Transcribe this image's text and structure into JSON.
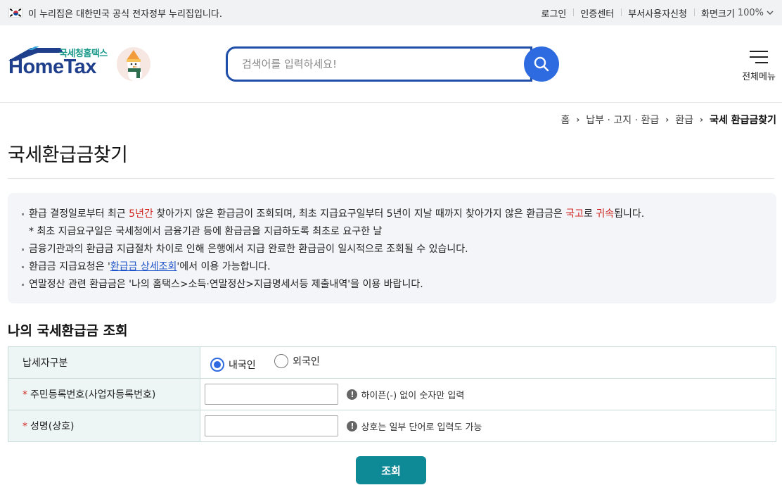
{
  "gov_bar": {
    "notice": "이 누리집은 대한민국 공식 전자정부 누리집입니다.",
    "links": [
      "로그인",
      "인증센터",
      "부서사용자신청"
    ],
    "zoom_label": "화면크기",
    "zoom_value": "100%"
  },
  "header": {
    "logo_sub": "국세청홈택스",
    "logo_main": "HomeTax",
    "search_placeholder": "검색어를 입력하세요!",
    "menu_label": "전체메뉴"
  },
  "breadcrumb": [
    "홈",
    "납부 · 고지 · 환급",
    "환급",
    "국세 환급금찾기"
  ],
  "page_title": "국세환급금찾기",
  "info": {
    "line1_a": "환급 결정일로부터 최근 ",
    "line1_red1": "5년간",
    "line1_b": " 찾아가지 않은 환급금이 조회되며, 최초 지급요구일부터 5년이 지날 때까지 찾아가지 않은 환급금은 ",
    "line1_red2": "국고",
    "line1_c": "로 ",
    "line1_red3": "귀속",
    "line1_d": "됩니다.",
    "note": "* 최초 지급요구일은 국세청에서 금융기관 등에 환급금을 지급하도록 최초로 요구한 날",
    "line2": "금융기관과의 환급금 지급절차 차이로 인해 은행에서 지급 완료한 환급금이 일시적으로 조회될 수 있습니다.",
    "line3_a": "환급금 지급요청은 '",
    "line3_link": "환급금 상세조회",
    "line3_b": "'에서 이용 가능합니다.",
    "line4": "연말정산 관련 환급금은 '나의 홈택스>소득·연말정산>지급명세서등 제출내역'을 이용 바랍니다."
  },
  "section_title": "나의 국세환급금 조회",
  "form": {
    "taxpayer_label": "납세자구분",
    "options": [
      "내국인",
      "외국인"
    ],
    "selected": "내국인",
    "id_label": "주민등록번호(사업자등록번호)",
    "id_hint": "하이픈(-) 없이 숫자만 입력",
    "id_value": "",
    "name_label": "성명(상호)",
    "name_hint": "상호는 일부 단어로 입력도 가능",
    "name_value": "",
    "required_mark": "*",
    "hint_icon": "!"
  },
  "submit_label": "조회",
  "colors": {
    "brand_navy": "#1f3f8c",
    "search_blue": "#2f6be0",
    "accent_red": "#d0231f",
    "submit_teal": "#0e8a96"
  }
}
